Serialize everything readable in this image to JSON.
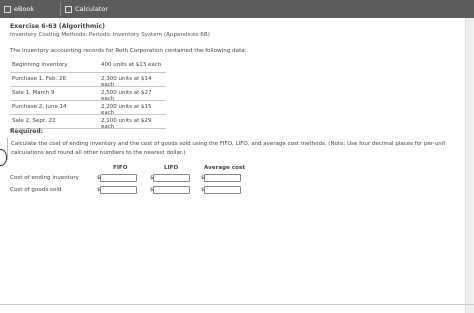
{
  "tabs": {
    "ebook": "eBook",
    "calculator": "Calculator"
  },
  "exercise": {
    "title": "Exercise 6-63 (Algorithmic)",
    "subtitle": "Inventory Costing Methods: Periodic Inventory System (Appendices 6B)",
    "intro": "The inventory accounting records for Roth Corporation contained the following data:"
  },
  "inventory": [
    {
      "label": "Beginning inventory",
      "value": "400 units at $13 each"
    },
    {
      "label": "Purchase 1, Feb. 26",
      "value": "2,300 units at $14 each"
    },
    {
      "label": "Sale 1, March 9",
      "value": "2,500 units at $27 each"
    },
    {
      "label": "Purchase 2, June 14",
      "value": "2,200 units at $15 each"
    },
    {
      "label": "Sale 2, Sept. 22",
      "value": "2,100 units at $29 each"
    }
  ],
  "required_label": "Required:",
  "instructions": "Calculate the cost of ending inventory and the cost of goods sold using the FIFO, LIFO, and average cost methods. (Note: Use four decimal places for per-unit calculations and round all other numbers to the nearest dollar.)",
  "answer_table": {
    "columns": [
      "FIFO",
      "LIFO",
      "Average cost"
    ],
    "rows": [
      "Cost of ending inventory",
      "Cost of goods sold"
    ],
    "currency": "$",
    "values": [
      [
        "",
        "",
        ""
      ],
      [
        "",
        "",
        ""
      ]
    ]
  }
}
